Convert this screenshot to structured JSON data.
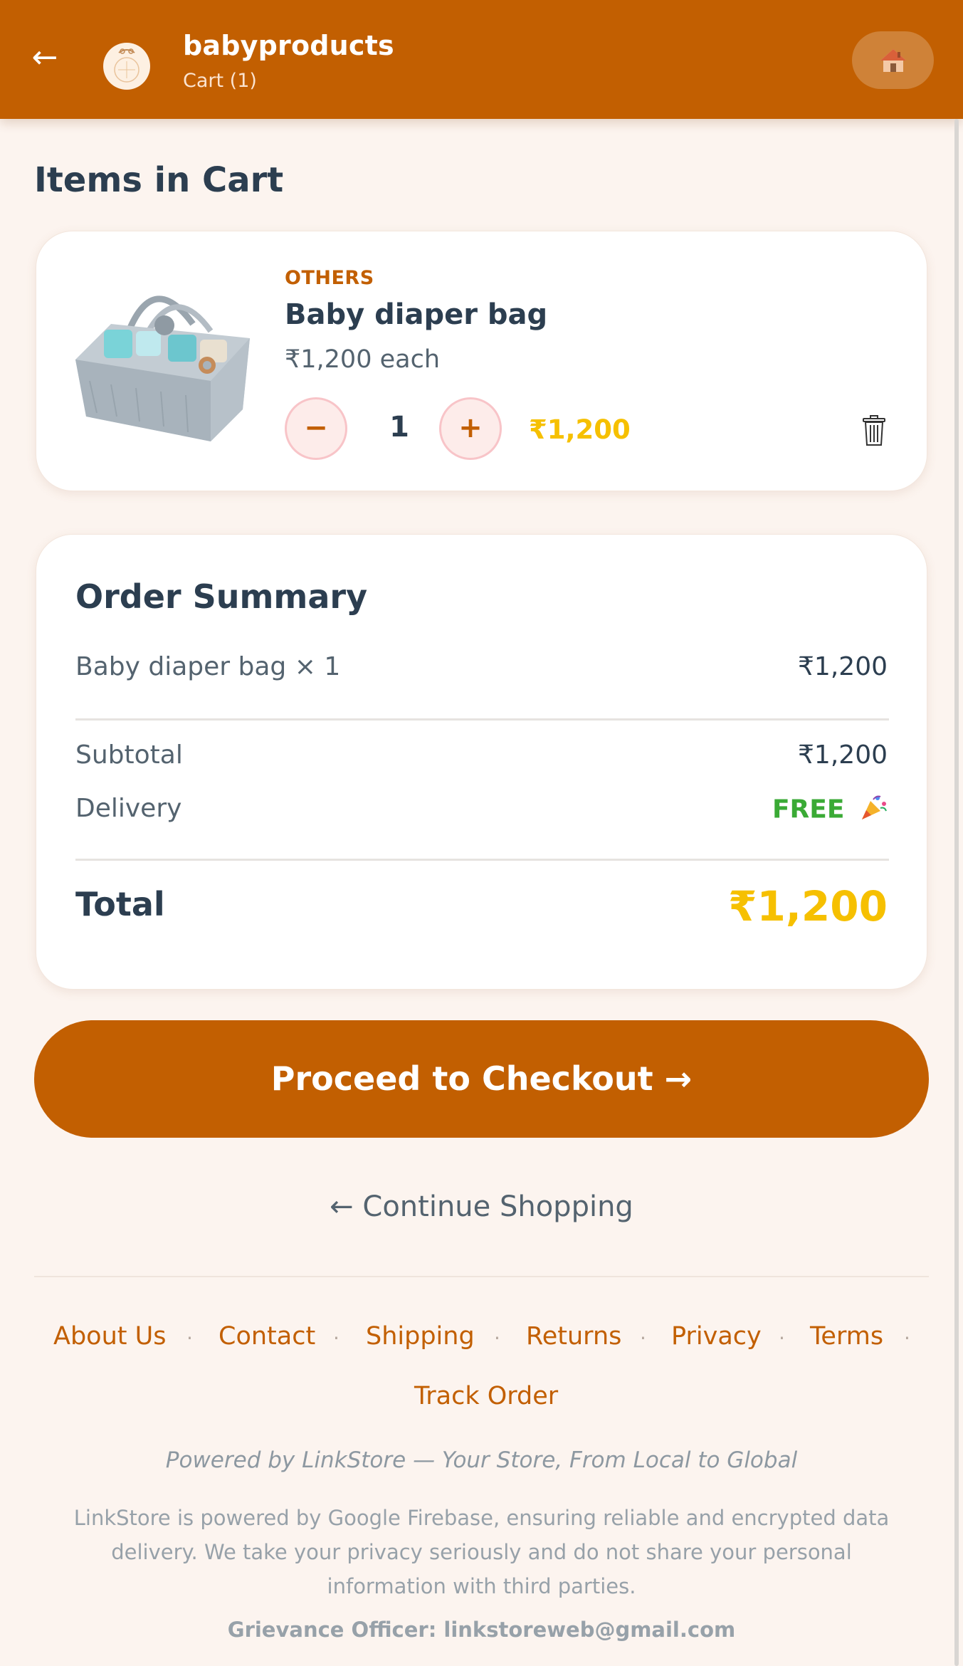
{
  "header": {
    "store_name": "babyproducts",
    "cart_label": "Cart (1)",
    "back_icon": "arrow-left-icon",
    "home_icon": "house-icon"
  },
  "cart": {
    "title": "Items in Cart",
    "items": [
      {
        "category": "OTHERS",
        "name": "Baby diaper bag",
        "unit_price": "₹1,200 each",
        "quantity": "1",
        "line_total": "₹1,200",
        "minus_label": "−",
        "plus_label": "+"
      }
    ]
  },
  "summary": {
    "title": "Order Summary",
    "line_item_label": "Baby diaper bag × 1",
    "line_item_value": "₹1,200",
    "subtotal_label": "Subtotal",
    "subtotal_value": "₹1,200",
    "delivery_label": "Delivery",
    "delivery_value": "FREE",
    "total_label": "Total",
    "total_value": "₹1,200"
  },
  "actions": {
    "checkout_label": "Proceed to Checkout →",
    "continue_label": "← Continue Shopping"
  },
  "footer": {
    "links": [
      "About Us",
      "Contact",
      "Shipping",
      "Returns",
      "Privacy",
      "Terms",
      "Track Order"
    ],
    "separator": "·",
    "powered_by": "Powered by LinkStore — Your Store, From Local to Global",
    "privacy_note": "LinkStore is powered by Google Firebase, ensuring reliable and encrypted data delivery. We take your privacy seriously and do not share your personal information with third parties.",
    "grievance": "Grievance Officer: linkstoreweb@gmail.com"
  },
  "colors": {
    "brand": "#c25f01",
    "price_accent": "#f6c000",
    "free_green": "#3aaa35",
    "background": "#fcf4ef"
  }
}
